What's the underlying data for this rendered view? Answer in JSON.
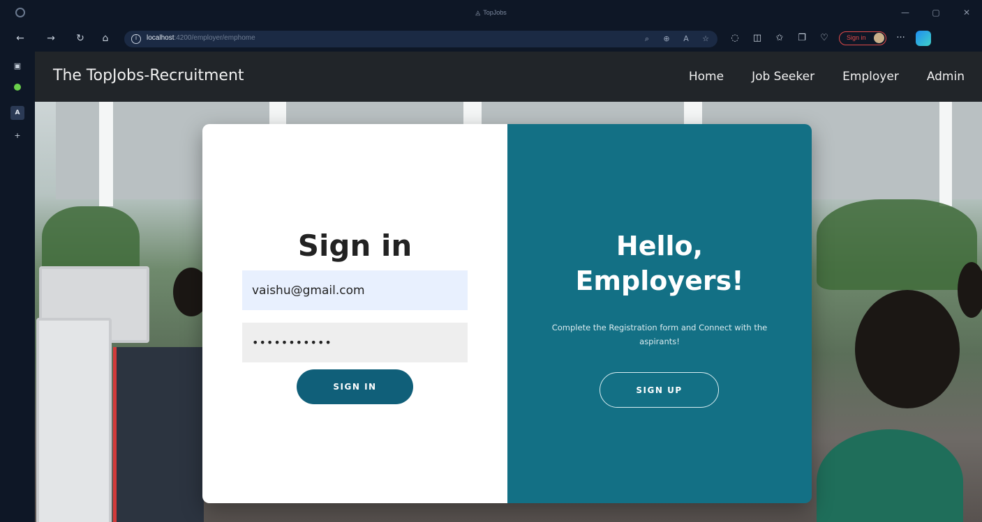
{
  "browser": {
    "window_title": "TopJobs",
    "url_host": "localhost",
    "url_path": ":4200/employer/emphome",
    "sign_in_label": "Sign in",
    "window_controls": [
      "—",
      "▢",
      "✕"
    ]
  },
  "site": {
    "brand": "The TopJobs-Recruitment",
    "nav": {
      "home": "Home",
      "job_seeker": "Job Seeker",
      "employer": "Employer",
      "admin": "Admin"
    }
  },
  "signin": {
    "title": "Sign in",
    "email_value": "vaishu@gmail.com",
    "password_value": "•••••••••••",
    "button": "SIGN IN"
  },
  "welcome": {
    "title_line1": "Hello,",
    "title_line2": "Employers!",
    "subtitle": "Complete the Registration form and Connect with the aspirants!",
    "button": "SIGN UP"
  },
  "colors": {
    "navbar_bg": "#212529",
    "panel_teal": "#137085",
    "signin_button": "#105f79",
    "email_field_bg": "#e8f0fe"
  }
}
